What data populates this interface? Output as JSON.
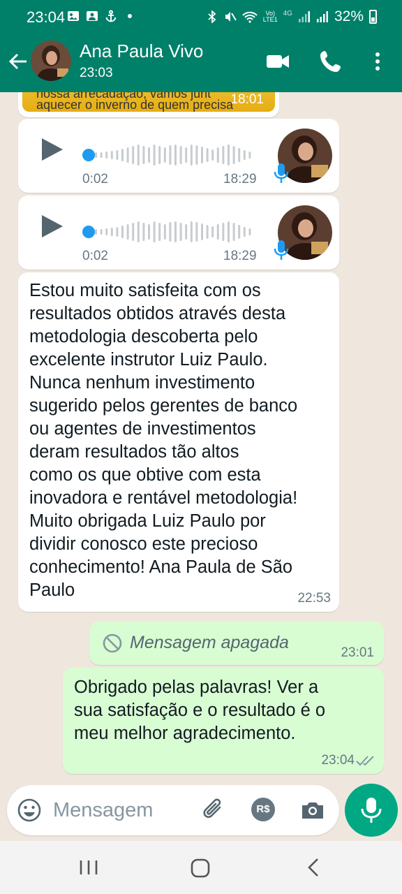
{
  "status_bar": {
    "time": "23:04",
    "volte_top": "Vo)",
    "volte_bottom": "LTE1",
    "network": "4G",
    "battery": "32%"
  },
  "header": {
    "contact_name": "Ana Paula Vivo",
    "last_seen": "23:03"
  },
  "messages": {
    "partial": {
      "line1": "nossa arrecadação, vamos junt",
      "line2": "aquecer o inverno de quem precisa",
      "time": "18:01"
    },
    "voice_notes": [
      {
        "duration": "0:02",
        "time": "18:29"
      },
      {
        "duration": "0:02",
        "time": "18:29"
      }
    ],
    "incoming_text": {
      "body": "Estou muito satisfeita com os\nresultados obtidos através desta\nmetodologia descoberta pelo\nexcelente instrutor Luiz Paulo.\nNunca nenhum investimento\nsugerido pelos gerentes de banco\nou agentes de investimentos\nderam resultados tão altos\ncomo os que obtive com esta\ninovadora e rentável metodologia!\nMuito obrigada Luiz Paulo por\ndividir conosco  este precioso\nconhecimento! Ana Paula de São\nPaulo",
      "time": "22:53"
    },
    "deleted": {
      "label": "Mensagem apagada",
      "time": "23:01"
    },
    "outgoing_text": {
      "body": "Obrigado pelas palavras! Ver a\nsua satisfação e o resultado é o\nmeu melhor agradecimento.",
      "time": "23:04"
    }
  },
  "composer": {
    "placeholder": "Mensagem",
    "pay_label": "R$"
  },
  "colors": {
    "header": "#008069",
    "accent": "#00a884",
    "chat_bg": "#efe7de",
    "outgoing_bubble": "#d9fdd3",
    "voice_progress": "#1e9bf0"
  }
}
